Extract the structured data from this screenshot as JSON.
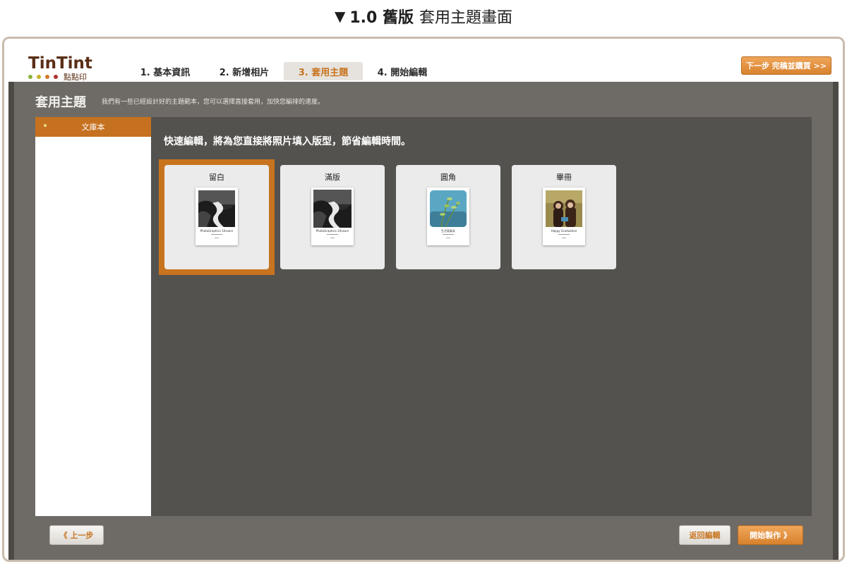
{
  "caption": {
    "marker": "▼",
    "version": "1.0 舊版",
    "text": "套用主題畫面"
  },
  "brand": {
    "name": "TinTint",
    "sub": "點點印",
    "dot_colors": [
      "#8cb33b",
      "#c9b227",
      "#d5782c",
      "#b0312a"
    ]
  },
  "steps": [
    {
      "label": "1. 基本資訊"
    },
    {
      "label": "2. 新增相片"
    },
    {
      "label": "3. 套用主題",
      "active": true
    },
    {
      "label": "4. 開始編輯"
    }
  ],
  "next_button": "下一步 完稿並購買 >>",
  "section": {
    "title": "套用主題",
    "description": "我們有一些已經設計好的主題範本，您可以選擇直接套用，加快您編排的速度。"
  },
  "sidebar": {
    "items": [
      {
        "label": "文庫本"
      }
    ]
  },
  "content": {
    "heading": "快速編輯，將為您直接將照片填入版型，節省編輯時間。",
    "themes": [
      {
        "title": "留白",
        "selected": true,
        "photo": "waterfall",
        "caption": "PhotoGraphics 10vears"
      },
      {
        "title": "滿版",
        "selected": false,
        "photo": "waterfall",
        "caption": "PhotoGraphics 10vears"
      },
      {
        "title": "圓角",
        "selected": false,
        "photo": "plant",
        "caption": "生活寫真本"
      },
      {
        "title": "畢冊",
        "selected": false,
        "photo": "girls",
        "caption": "Happy Graduation"
      }
    ]
  },
  "footer": {
    "prev": "《 上一步",
    "back_edit": "返回編輯",
    "start": "開始製作 》"
  },
  "colors": {
    "accent": "#c8741f",
    "panel": "#6e6b66",
    "content_bg": "#54524e"
  }
}
